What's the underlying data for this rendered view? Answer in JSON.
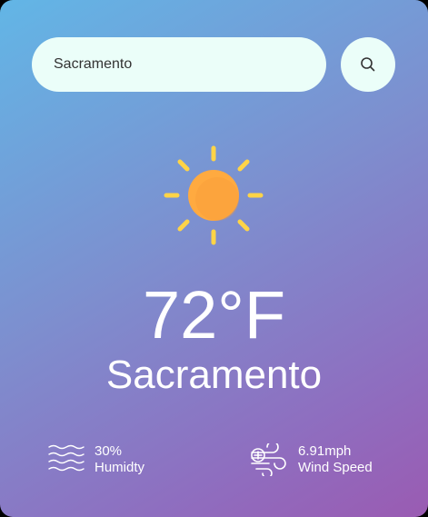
{
  "search": {
    "value": "Sacramento",
    "placeholder": ""
  },
  "icons": {
    "search": "search-icon",
    "weather": "sun-icon",
    "humidity": "humidity-waves-icon",
    "wind": "wind-icon"
  },
  "weather": {
    "temperature": "72°F",
    "city": "Sacramento",
    "humidity": {
      "value": "30%",
      "label": "Humidty"
    },
    "wind": {
      "value": "6.91mph",
      "label": "Wind Speed"
    }
  },
  "colors": {
    "gradient_start": "#62b6e6",
    "gradient_end": "#9a5bb2",
    "input_bg": "#ebfef9",
    "sun": "#ffaa40",
    "sun_rays": "#ffd447"
  }
}
